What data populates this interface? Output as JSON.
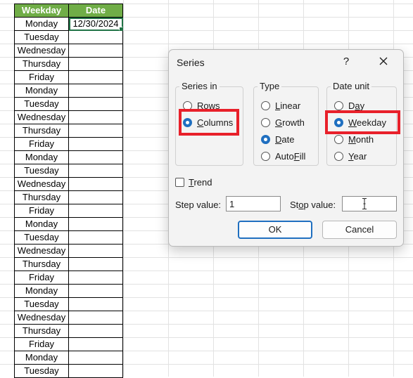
{
  "sheet": {
    "headers": [
      "Weekday",
      "Date"
    ],
    "header_color": "#70ad47",
    "first_date": "12/30/2024",
    "weekdays": [
      "Monday",
      "Tuesday",
      "Wednesday",
      "Thursday",
      "Friday",
      "Monday",
      "Tuesday",
      "Wednesday",
      "Thursday",
      "Friday",
      "Monday",
      "Tuesday",
      "Wednesday",
      "Thursday",
      "Friday",
      "Monday",
      "Tuesday",
      "Wednesday",
      "Thursday",
      "Friday",
      "Monday",
      "Tuesday",
      "Wednesday",
      "Thursday",
      "Friday",
      "Monday",
      "Tuesday"
    ]
  },
  "dialog": {
    "title": "Series",
    "help_label": "?",
    "close_icon": "close-icon",
    "series_in": {
      "label": "Series in",
      "options": [
        "Rows",
        "Columns"
      ],
      "selected": "Columns"
    },
    "type": {
      "label": "Type",
      "options": [
        "Linear",
        "Growth",
        "Date",
        "AutoFill"
      ],
      "selected": "Date"
    },
    "date_unit": {
      "label": "Date unit",
      "options": [
        "Day",
        "Weekday",
        "Month",
        "Year"
      ],
      "selected": "Weekday"
    },
    "trend_label": "Trend",
    "trend_checked": false,
    "step_label": "Step value:",
    "step_value": "1",
    "stop_label": "Stop value:",
    "stop_value": "",
    "ok_label": "OK",
    "cancel_label": "Cancel",
    "accent_color": "#1f6fc0",
    "highlight_color": "#e8202a"
  }
}
